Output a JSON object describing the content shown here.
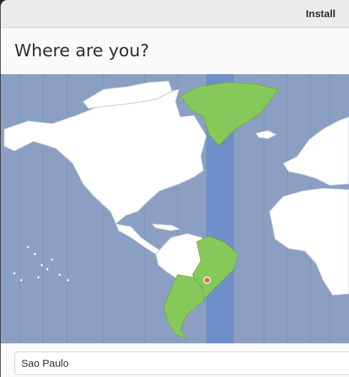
{
  "window": {
    "title": "Install"
  },
  "page": {
    "heading": "Where are you?"
  },
  "timezone_map": {
    "ocean_color": "#8b9fc3",
    "land_color": "#ffffff",
    "selected_region_color": "#86c95a",
    "selected_band_color": "#6e8fc8",
    "marker_color": "#e0625e"
  },
  "location": {
    "value": "Sao Paulo"
  }
}
